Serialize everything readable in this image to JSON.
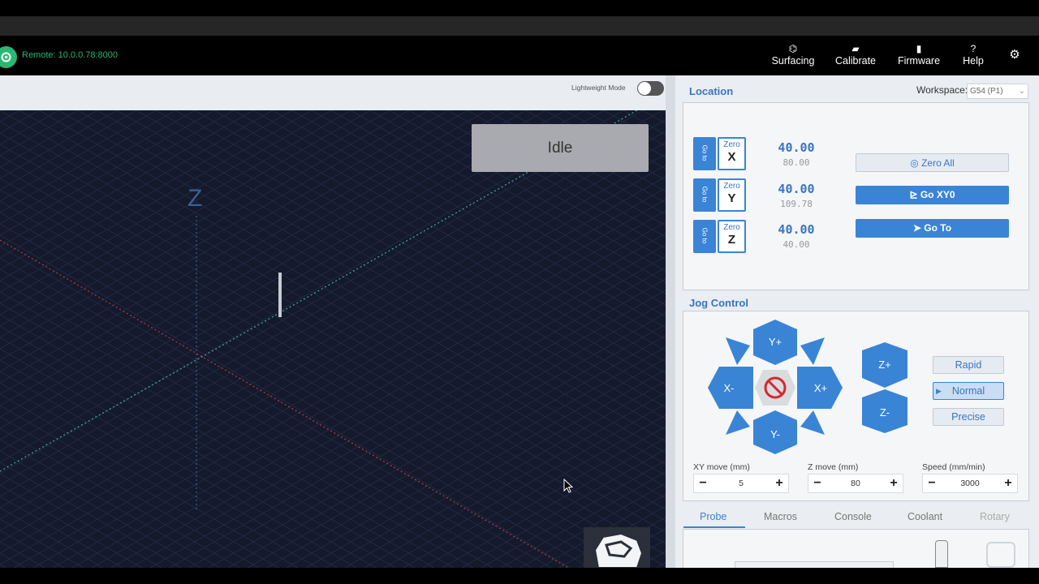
{
  "header": {
    "remote_text": "Remote: 10.0.0.78:8000",
    "nav": [
      {
        "label": "Surfacing",
        "icon": "surfacing-icon"
      },
      {
        "label": "Calibrate",
        "icon": "calibrate-icon"
      },
      {
        "label": "Firmware",
        "icon": "firmware-icon"
      },
      {
        "label": "Help",
        "icon": "help-icon"
      }
    ]
  },
  "visualizer": {
    "lightweight_label": "Lightweight Mode",
    "status": "Idle",
    "z_axis_label": "Z"
  },
  "location": {
    "title": "Location",
    "workspace_label": "Workspace:",
    "workspace_value": "G54 (P1)",
    "axes": [
      {
        "go": "Go to",
        "zero": "Zero",
        "axis": "X",
        "work": "40.00",
        "machine": "80.00"
      },
      {
        "go": "Go to",
        "zero": "Zero",
        "axis": "Y",
        "work": "40.00",
        "machine": "109.78"
      },
      {
        "go": "Go to",
        "zero": "Zero",
        "axis": "Z",
        "work": "40.00",
        "machine": "40.00"
      }
    ],
    "zero_all": "Zero All",
    "go_xy0": "Go XY0",
    "go_to": "Go To"
  },
  "jog": {
    "title": "Jog Control",
    "y_plus": "Y+",
    "y_minus": "Y-",
    "x_plus": "X+",
    "x_minus": "X-",
    "z_plus": "Z+",
    "z_minus": "Z-",
    "speeds": [
      "Rapid",
      "Normal",
      "Precise"
    ],
    "active_speed": "Normal",
    "xy_label": "XY move (mm)",
    "xy_value": "5",
    "z_label": "Z move (mm)",
    "z_value": "80",
    "speed_label": "Speed (mm/min)",
    "speed_value": "3000"
  },
  "tabs": [
    "Probe",
    "Macros",
    "Console",
    "Coolant",
    "Rotary"
  ],
  "colors": {
    "accent": "#3a84d6",
    "brand": "#2bb673",
    "viz_bg": "#14192b",
    "idle_bg": "#a9aaaf"
  }
}
